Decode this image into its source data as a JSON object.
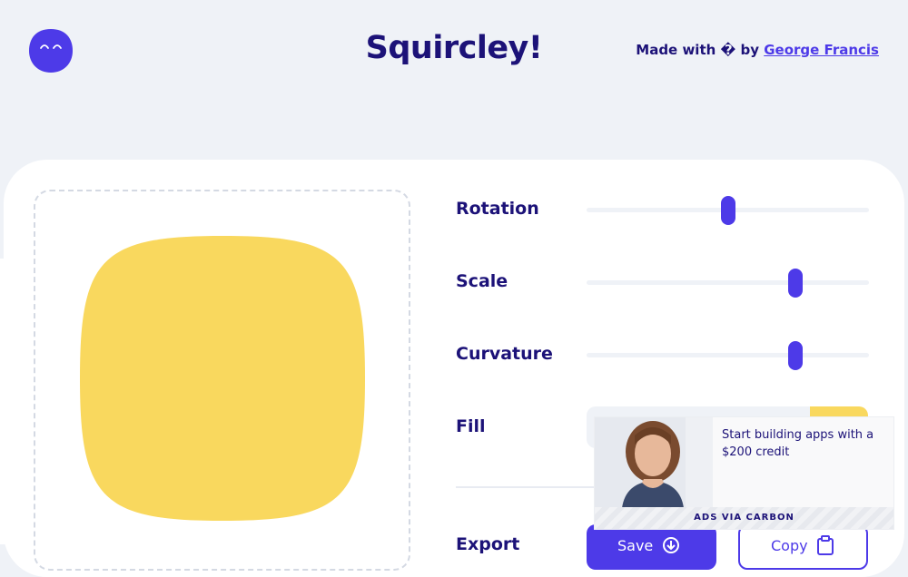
{
  "header": {
    "title": "Squircley!",
    "credit_prefix": "Made with",
    "credit_heart": "�",
    "credit_by": "by",
    "credit_author": "George Francis"
  },
  "controls": {
    "rotation": {
      "label": "Rotation",
      "value": 0.5
    },
    "scale": {
      "label": "Scale",
      "value": 0.74
    },
    "curvature": {
      "label": "Curvature",
      "value": 0.74
    },
    "fill": {
      "label": "Fill",
      "value": "",
      "color": "#f9d85e"
    },
    "export": {
      "label": "Export",
      "save_label": "Save",
      "copy_label": "Copy"
    }
  },
  "ad": {
    "text": "Start building apps with a $200 credit",
    "footer": "ADS VIA CARBON"
  },
  "colors": {
    "accent": "#4d3ae8",
    "text": "#1c1278",
    "background": "#eff2f7",
    "shape_fill": "#f9d85e"
  }
}
